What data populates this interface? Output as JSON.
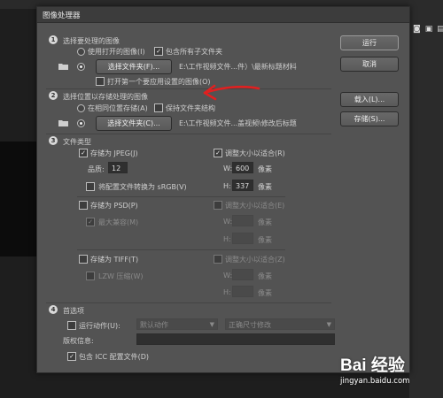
{
  "dialog": {
    "title": "图像处理器"
  },
  "buttons": {
    "run": "运行",
    "cancel": "取消",
    "load": "载入(L)...",
    "save": "存储(S)..."
  },
  "section1": {
    "num": "1",
    "title": "选择要处理的图像",
    "use_open": "使用打开的图像(I)",
    "include_subfolders": "包含所有子文件夹",
    "select_folder": "选择文件夹(F)...",
    "path": "E:\\工作视频文件...件）\\最新标题材料",
    "open_first": "打开第一个要应用设置的图像(O)"
  },
  "section2": {
    "num": "2",
    "title": "选择位置以存储处理的图像",
    "same_location": "在相同位置存储(A)",
    "keep_structure": "保持文件夹结构",
    "select_folder": "选择文件夹(C)...",
    "path": "E:\\工作视频文件...盖视频\\修改后标题"
  },
  "section3": {
    "num": "3",
    "title": "文件类型",
    "jpeg": {
      "save_as": "存储为 JPEG(J)",
      "resize": "调整大小以适合(R)",
      "quality_label": "品质:",
      "quality": "12",
      "w_label": "W:",
      "w_value": "600",
      "h_label": "H:",
      "h_value": "337",
      "unit": "像素",
      "convert": "将配置文件转换为 sRGB(V)"
    },
    "psd": {
      "save_as": "存储为 PSD(P)",
      "resize": "调整大小以适合(E)",
      "maximize": "最大兼容(M)",
      "w_label": "W:",
      "h_label": "H:",
      "unit": "像素"
    },
    "tiff": {
      "save_as": "存储为 TIFF(T)",
      "resize": "调整大小以适合(Z)",
      "lzw": "LZW 压缩(W)",
      "w_label": "W:",
      "h_label": "H:",
      "unit": "像素"
    }
  },
  "section4": {
    "num": "4",
    "title": "首选项",
    "run_action": "运行动作(U):",
    "action_set": "默认动作",
    "action": "正确尺寸修改",
    "copyright_label": "版权信息:",
    "copyright": "",
    "include_icc": "包含 ICC 配置文件(D)"
  },
  "watermark": {
    "logo": "Bai 经验",
    "url": "jingyan.baidu.com"
  },
  "colors": {
    "dialog_bg": "#535353",
    "annotation": "#e02020"
  }
}
